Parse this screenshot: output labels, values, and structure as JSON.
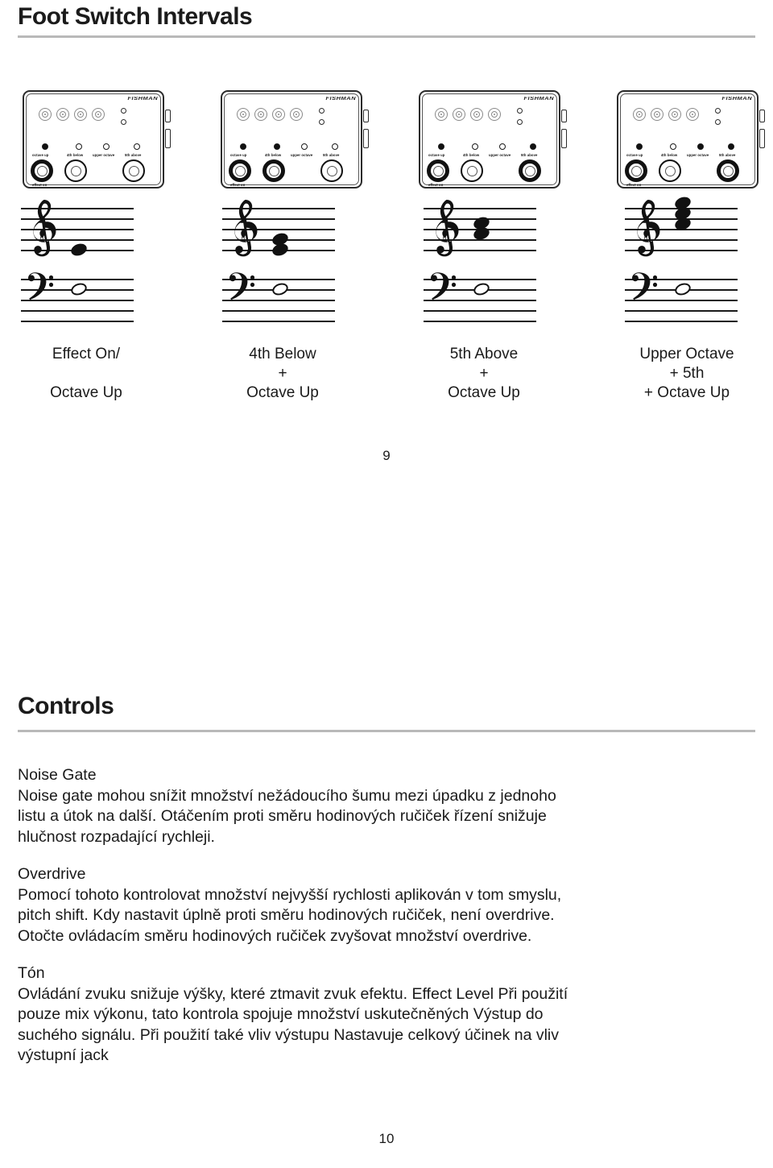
{
  "page": {
    "top_page_number": "9",
    "bottom_page_number": "10"
  },
  "sections": {
    "foot_switch": {
      "title": "Foot Switch Intervals"
    },
    "controls": {
      "title": "Controls"
    }
  },
  "pedal_switch_labels": {
    "octave_up": "octave up",
    "fourth_below": "4th below",
    "upper_octave": "upper octave",
    "fifth_above": "5th above",
    "effect_on": "effect on",
    "brand": "FISHMAN"
  },
  "pedals": [
    {
      "name": "pedal-1",
      "octave_up": true,
      "fourth_below": false,
      "upper_octave": false,
      "fifth_above": false
    },
    {
      "name": "pedal-2",
      "octave_up": true,
      "fourth_below": true,
      "upper_octave": false,
      "fifth_above": false
    },
    {
      "name": "pedal-3",
      "octave_up": true,
      "fourth_below": false,
      "upper_octave": false,
      "fifth_above": true
    },
    {
      "name": "pedal-4",
      "octave_up": true,
      "fourth_below": false,
      "upper_octave": true,
      "fifth_above": true
    }
  ],
  "staves": [
    {
      "name": "staff-1",
      "treble_notes": [
        1
      ],
      "bass_notes": [
        1
      ]
    },
    {
      "name": "staff-2",
      "treble_notes": [
        2
      ],
      "bass_notes": [
        1
      ]
    },
    {
      "name": "staff-3",
      "treble_notes": [
        2
      ],
      "bass_notes": [
        1
      ]
    },
    {
      "name": "staff-4",
      "treble_notes": [
        3
      ],
      "bass_notes": [
        1
      ]
    }
  ],
  "captions": [
    {
      "line1": "Effect On/",
      "line2": "",
      "line3": "Octave Up"
    },
    {
      "line1": "4th Below",
      "line2": "+",
      "line3": "Octave Up"
    },
    {
      "line1": "5th Above",
      "line2": "+",
      "line3": "Octave Up"
    },
    {
      "line1": "Upper Octave",
      "line2": "+ 5th",
      "line3": "+ Octave Up"
    }
  ],
  "controls_text": {
    "noise_gate_title": "Noise Gate",
    "noise_gate_body": "Noise gate mohou snížit množství nežádoucího šumu mezi úpadku z jednoho listu a útok na další. Otáčením proti směru hodinových ručiček řízení snižuje hlučnost rozpadající rychleji.",
    "overdrive_title": "Overdrive",
    "overdrive_body": "Pomocí tohoto kontrolovat množství nejvyšší rychlosti aplikován v tom smyslu, pitch shift. Kdy nastavit úplně proti směru hodinových ručiček, není overdrive. Otočte ovládacím směru hodinových ručiček zvyšovat množství overdrive.",
    "tone_title": "Tón",
    "tone_body": "Ovládání zvuku snižuje výšky, které ztmavit zvuk efektu. Effect Level Při použití pouze mix výkonu, tato kontrola spojuje množství uskutečněných Výstup do suchého signálu. Při použití také vliv výstupu Nastavuje celkový účinek na vliv výstupní jack"
  },
  "colors": {
    "text": "#1a1a1a",
    "rule": "#b9b9b9",
    "ink": "#111111"
  }
}
